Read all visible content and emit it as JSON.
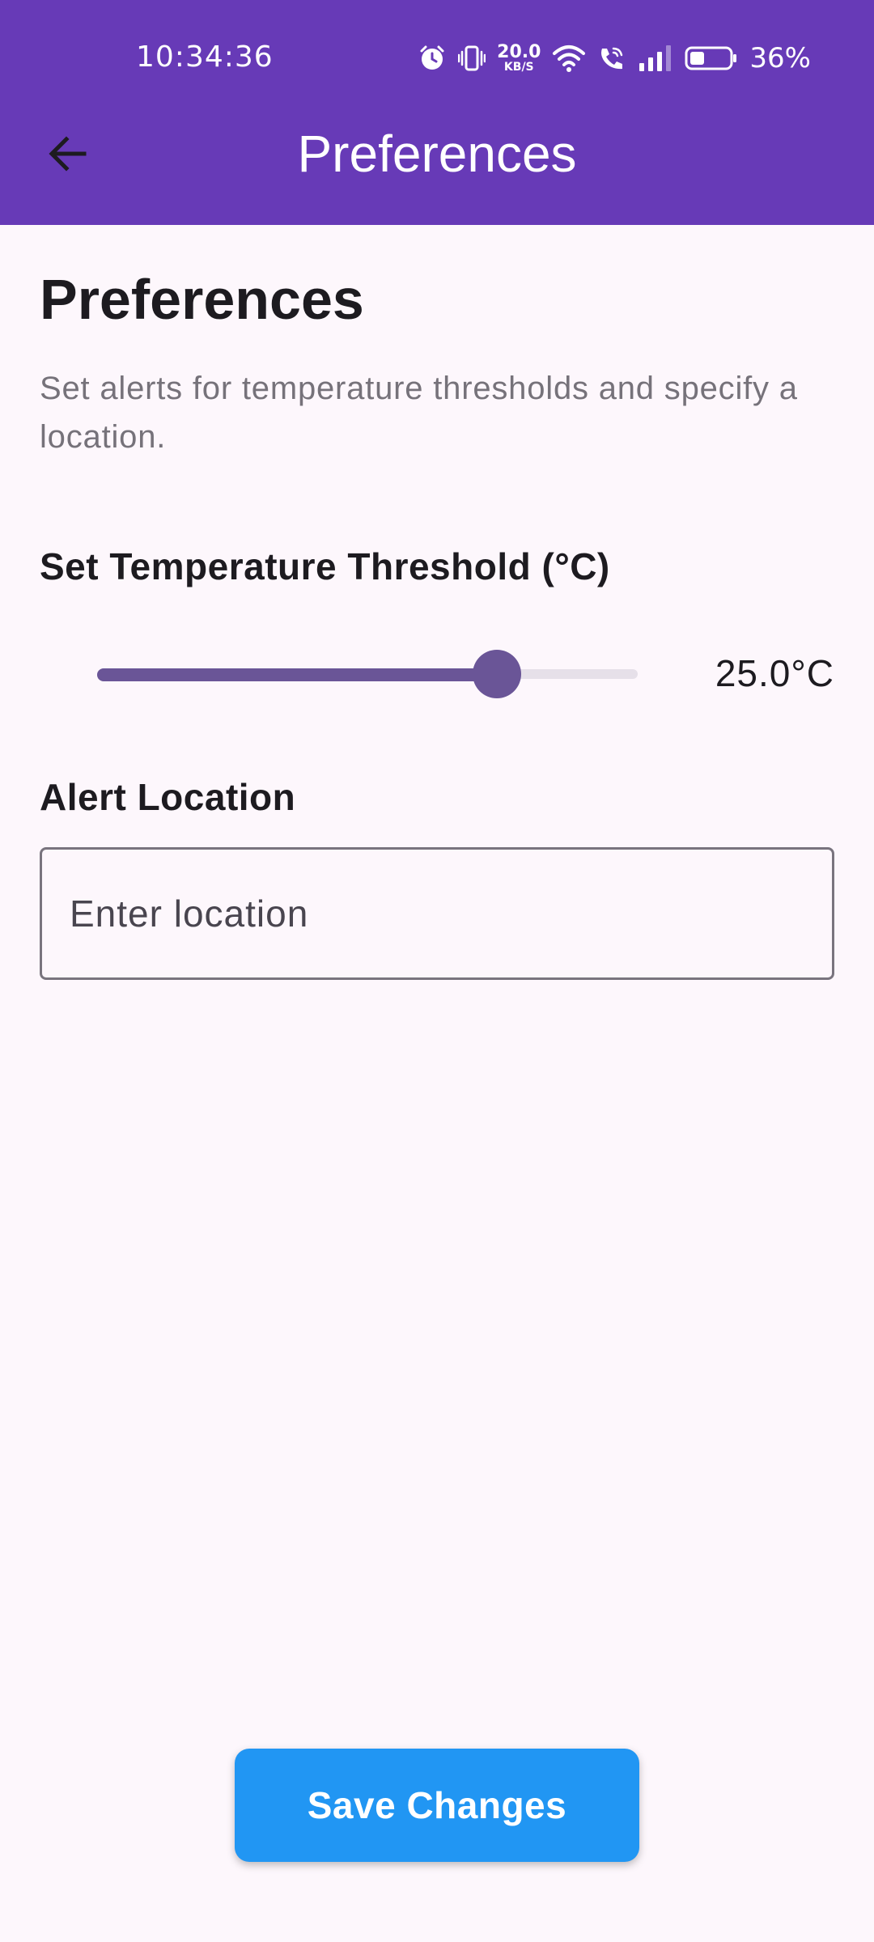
{
  "status_bar": {
    "time": "10:34:36",
    "net_speed_value": "20.0",
    "net_speed_unit": "KB/S",
    "battery_percent": "36%",
    "icons": [
      "alarm-icon",
      "vibrate-icon",
      "net-speed",
      "wifi-icon",
      "wifi-call-icon",
      "signal-icon",
      "battery-icon"
    ],
    "battery_level": 0.36
  },
  "app_bar": {
    "title": "Preferences",
    "back_icon": "arrow-back-icon",
    "background": "#673ab7"
  },
  "main": {
    "heading": "Preferences",
    "description": "Set alerts for temperature thresholds and specify a location.",
    "threshold": {
      "label": "Set Temperature Threshold (°C)",
      "value_text": "25.0°C",
      "fraction": 0.74,
      "color": "#6a5597"
    },
    "location": {
      "label": "Alert Location",
      "placeholder": "Enter location",
      "value": ""
    }
  },
  "save_button": {
    "label": "Save Changes",
    "color": "#2196f3"
  }
}
